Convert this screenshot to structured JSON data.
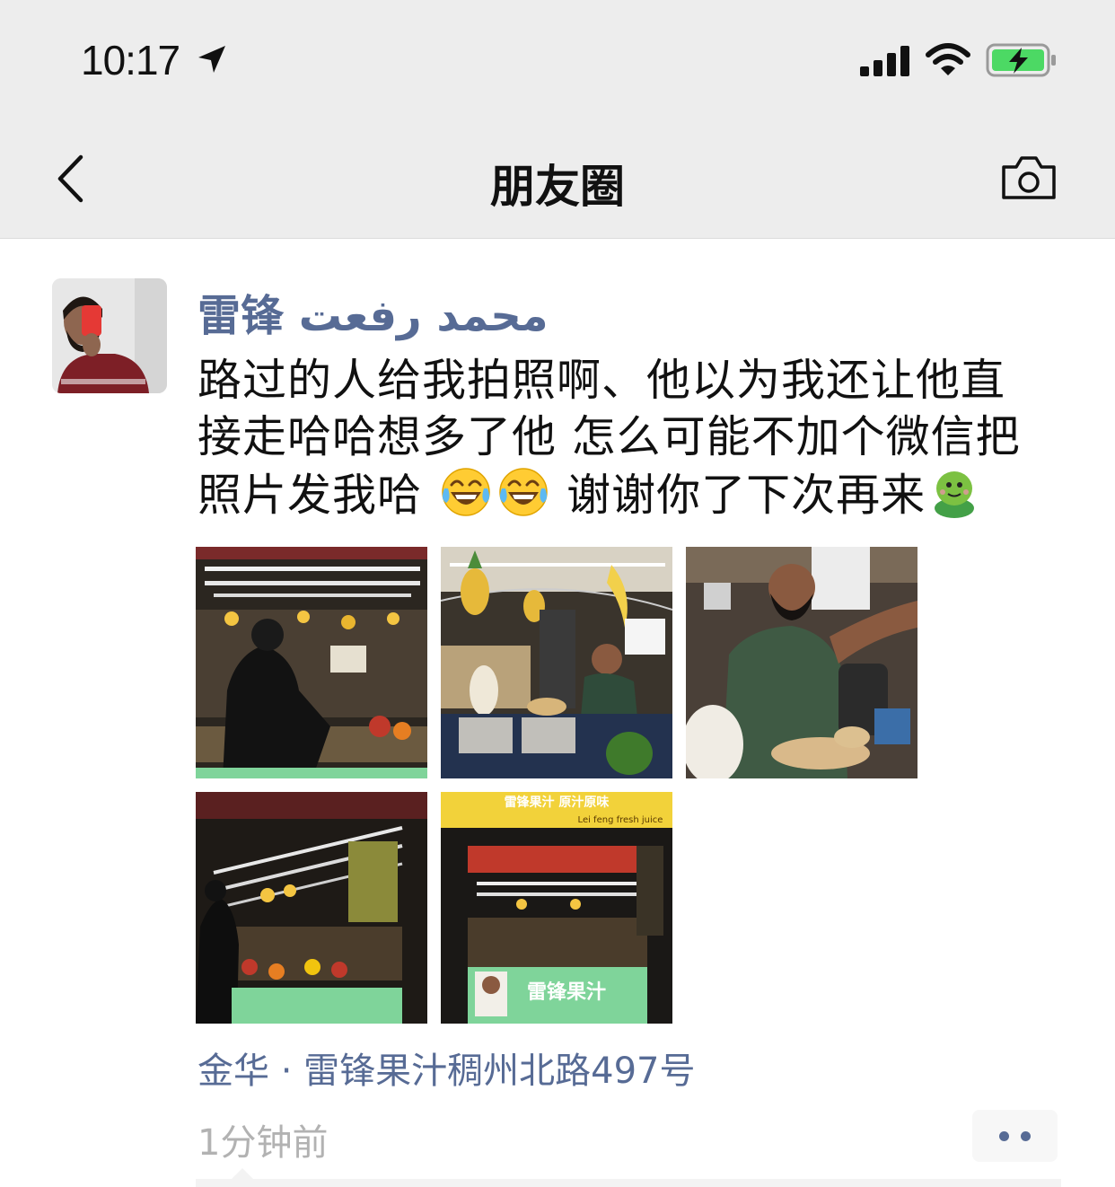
{
  "status_bar": {
    "time": "10:17"
  },
  "nav": {
    "title": "朋友圈"
  },
  "post": {
    "username": "雷锋 محمد رفعت",
    "text_line1": "路过的人给我拍照啊、他以为我还让他直",
    "text_line2": "接走哈哈想多了他 怎么可能不加个微信把",
    "text_line3a": "照片发我哈",
    "text_line3b": "谢谢你了下次再来",
    "emojis": [
      "tears-of-joy",
      "tears-of-joy",
      "green-frog"
    ],
    "photo_texts": {
      "sign_top": "雷锋果汁 原汁原味",
      "sign_sub": "Lei feng fresh juice",
      "sign_green": "雷锋果汁"
    },
    "location": "金华 · 雷锋果汁稠州北路497号",
    "timestamp": "1分钟前"
  },
  "colors": {
    "link": "#576b95",
    "nav_bg": "#ededed",
    "battery": "#4cd964"
  }
}
